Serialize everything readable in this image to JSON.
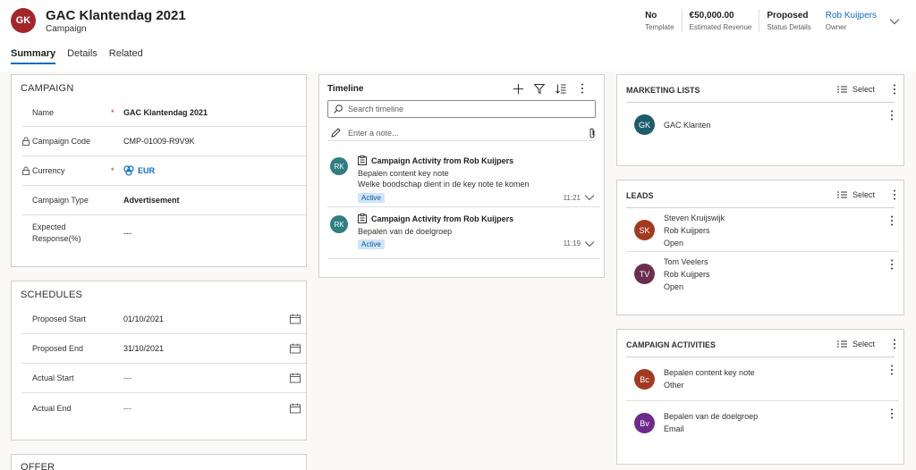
{
  "header": {
    "avatar_initials": "GK",
    "avatar_color": "#a4262c",
    "title": "GAC Klantendag 2021",
    "entity": "Campaign",
    "fields": [
      {
        "value": "No",
        "label": "Template"
      },
      {
        "value": "€50,000.00",
        "label": "Estimated Revenue"
      },
      {
        "value": "Proposed",
        "label": "Status Details"
      },
      {
        "value": "Rob Kuijpers",
        "label": "Owner"
      }
    ]
  },
  "tabs": [
    {
      "label": "Summary"
    },
    {
      "label": "Details"
    },
    {
      "label": "Related"
    }
  ],
  "campaign": {
    "title": "CAMPAIGN",
    "name_label": "Name",
    "name_value": "GAC Klantendag 2021",
    "code_label": "Campaign Code",
    "code_value": "CMP-01009-R9V9K",
    "currency_label": "Currency",
    "currency_value": "EUR",
    "type_label": "Campaign Type",
    "type_value": "Advertisement",
    "expected_label_1": "Expected",
    "expected_label_2": "Response(%)",
    "expected_value": "---",
    "required_mark": "*"
  },
  "schedules": {
    "title": "SCHEDULES",
    "rows": [
      {
        "label": "Proposed Start",
        "value": "01/10/2021"
      },
      {
        "label": "Proposed End",
        "value": "31/10/2021"
      },
      {
        "label": "Actual Start",
        "value": "---"
      },
      {
        "label": "Actual End",
        "value": "---"
      }
    ]
  },
  "offer": {
    "title": "OFFER"
  },
  "timeline": {
    "title": "Timeline",
    "search_placeholder": "Search timeline",
    "note_placeholder": "Enter a note...",
    "items": [
      {
        "initials": "RK",
        "title": "Campaign Activity from Rob Kuijpers",
        "line1": "Bepalen content key note",
        "line2": "Welke boodschap dient in de key note te komen",
        "status": "Active",
        "time": "11:21"
      },
      {
        "initials": "RK",
        "title": "Campaign Activity from Rob Kuijpers",
        "line1": "Bepalen van de doelgroep",
        "line2": "",
        "status": "Active",
        "time": "11:19"
      }
    ]
  },
  "select_label": "Select",
  "marketing_lists": {
    "title": "MARKETING LISTS",
    "items": [
      {
        "initials": "GK",
        "color": "#1e5c6b",
        "lines": [
          "GAC Klanten"
        ]
      }
    ]
  },
  "leads": {
    "title": "LEADS",
    "items": [
      {
        "initials": "SK",
        "color": "#a33a20",
        "lines": [
          "Steven Kruijswijk",
          "Rob Kuijpers",
          "Open"
        ]
      },
      {
        "initials": "TV",
        "color": "#6b2e4e",
        "lines": [
          "Tom Veelers",
          "Rob Kuijpers",
          "Open"
        ]
      }
    ]
  },
  "campaign_activities": {
    "title": "CAMPAIGN ACTIVITIES",
    "items": [
      {
        "initials": "Bc",
        "color": "#a33a20",
        "lines": [
          "Bepalen content key note",
          "Other"
        ]
      },
      {
        "initials": "Bv",
        "color": "#6b2a8c",
        "lines": [
          "Bepalen van de doelgroep",
          "Email"
        ]
      }
    ]
  },
  "colors": {
    "accent": "#0f6cbd",
    "active_badge": "#cfe4fa",
    "timeline_avatar": "#2f7e81"
  }
}
